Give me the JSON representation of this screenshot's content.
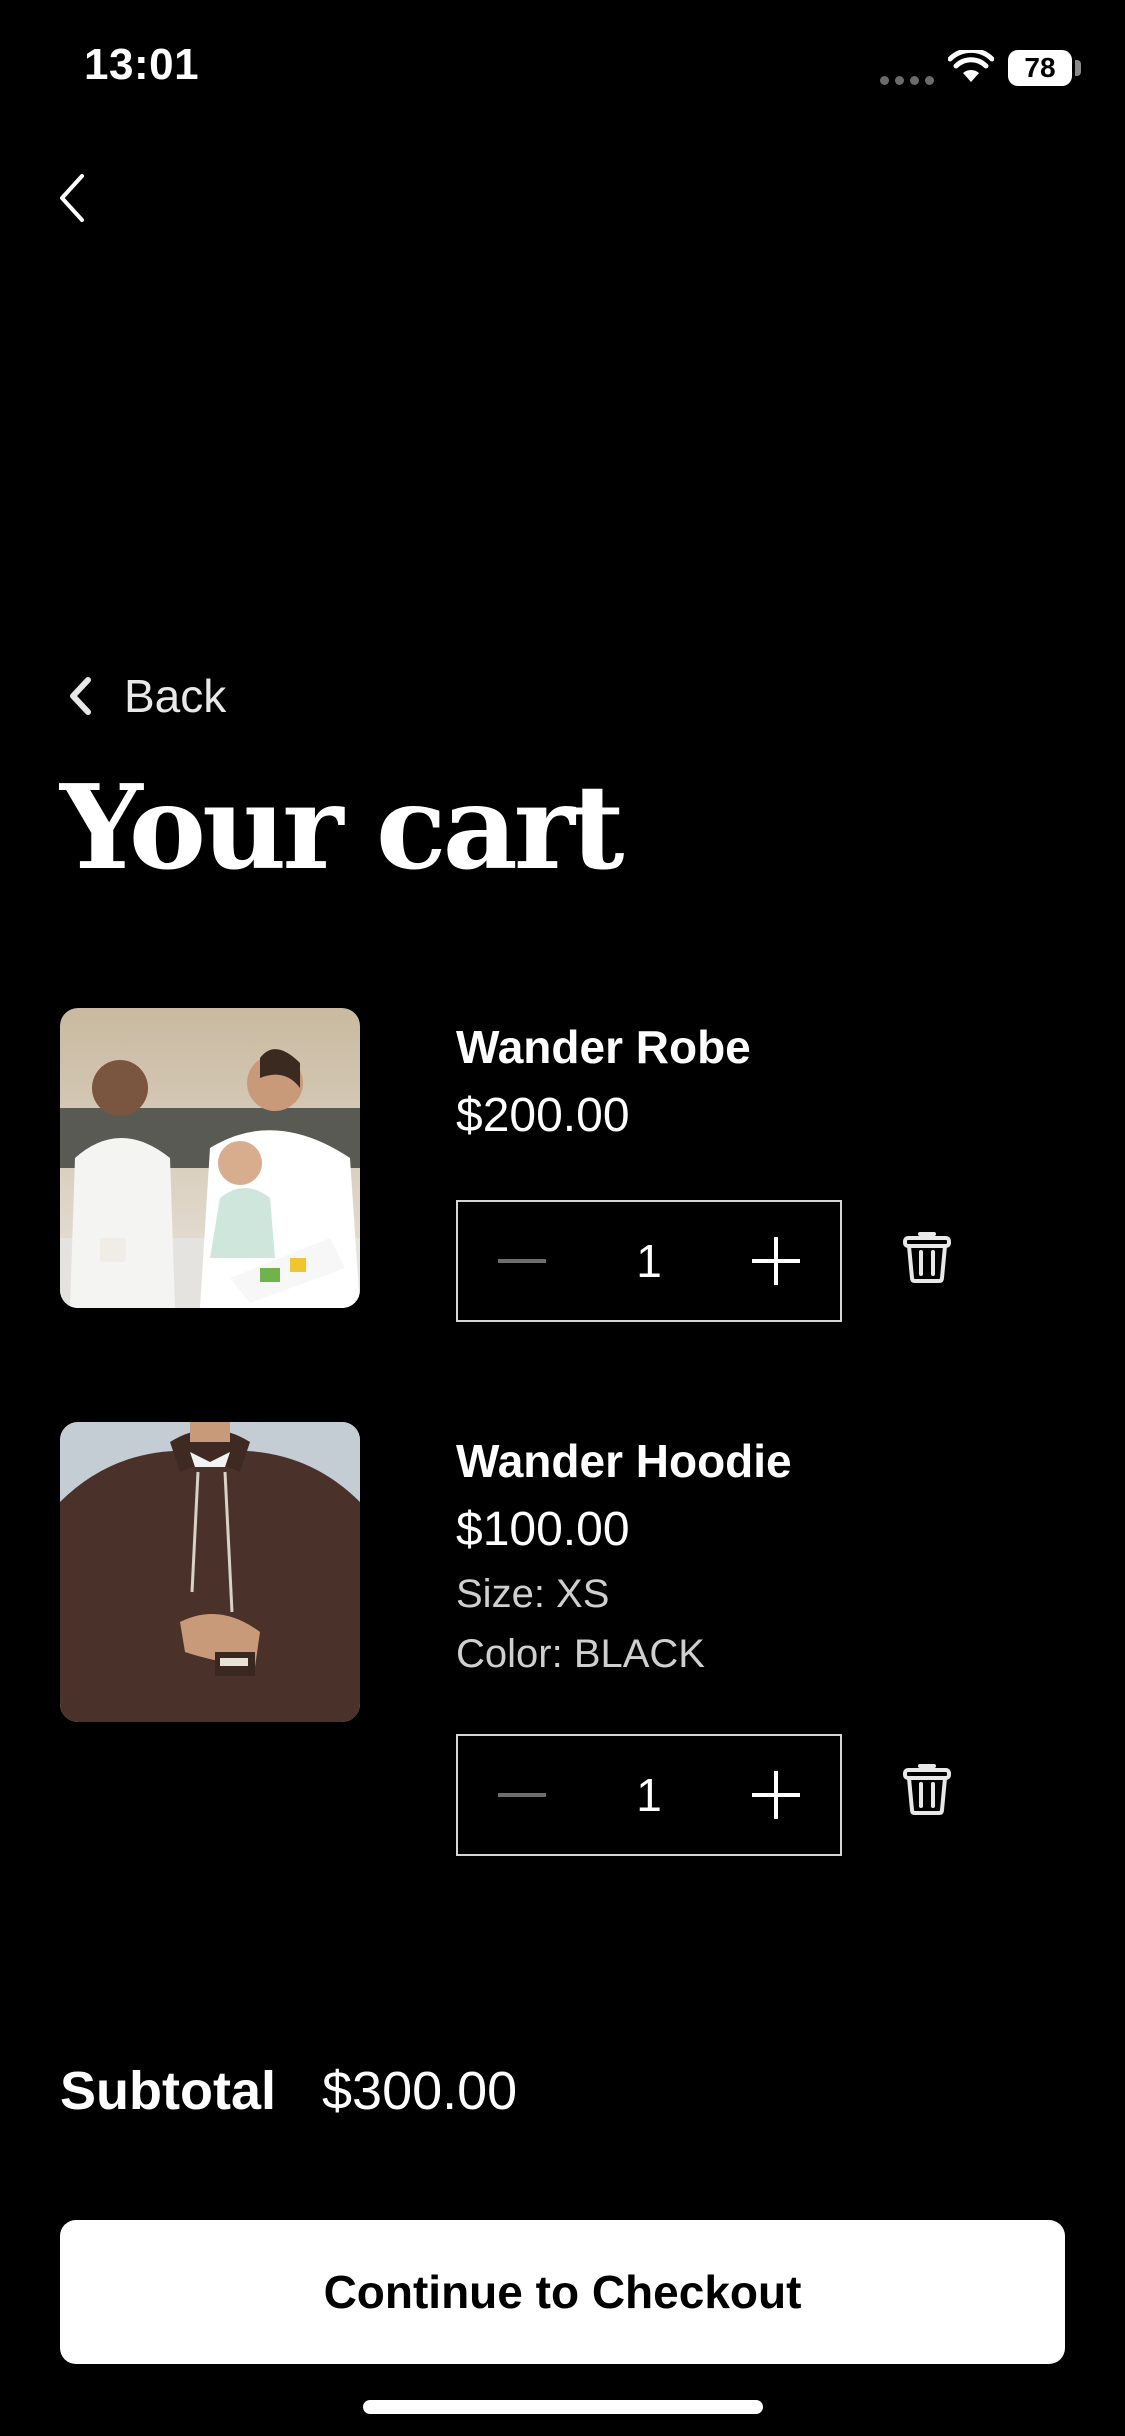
{
  "status_bar": {
    "time": "13:01",
    "battery": "78"
  },
  "nav": {
    "back_label": "Back",
    "page_title": "Your cart"
  },
  "cart": {
    "items": [
      {
        "name": "Wander Robe",
        "price": "$200.00",
        "quantity": "1",
        "image": "photo-family-in-white-robes"
      },
      {
        "name": "Wander Hoodie",
        "price": "$100.00",
        "size": "Size: XS",
        "color": "Color: BLACK",
        "quantity": "1",
        "image": "photo-brown-hoodie"
      }
    ]
  },
  "summary": {
    "subtotal_label": "Subtotal",
    "subtotal_value": "$300.00"
  },
  "checkout": {
    "label": "Continue to Checkout"
  },
  "colors": {
    "background": "#000000",
    "text": "#ffffff",
    "button_bg": "#ffffff",
    "button_text": "#000000"
  }
}
